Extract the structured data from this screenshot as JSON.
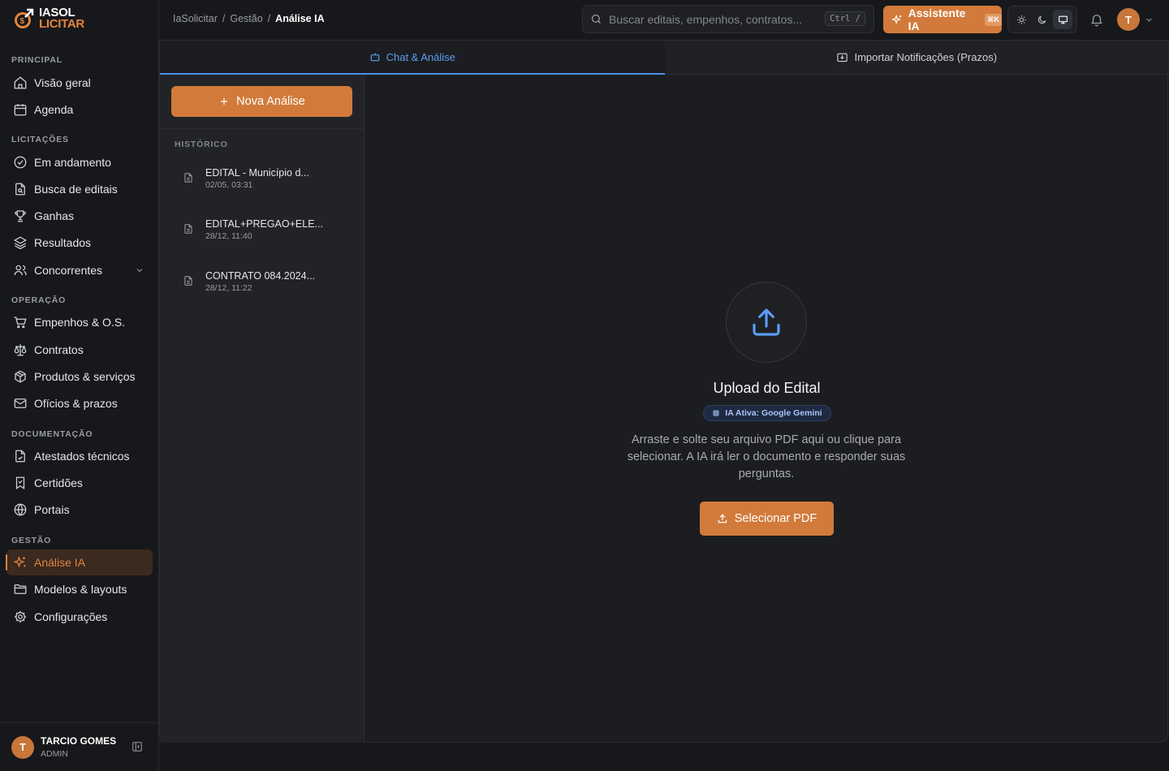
{
  "brand": {
    "line1": "IASOL",
    "line2": "LICITAR"
  },
  "sidebar": {
    "sections": [
      {
        "label": "Principal",
        "items": [
          {
            "label": "Visão geral",
            "icon": "home-icon"
          },
          {
            "label": "Agenda",
            "icon": "calendar-icon"
          }
        ]
      },
      {
        "label": "Licitações",
        "items": [
          {
            "label": "Em andamento",
            "icon": "check-circle-icon"
          },
          {
            "label": "Busca de editais",
            "icon": "file-search-icon"
          },
          {
            "label": "Ganhas",
            "icon": "trophy-icon"
          },
          {
            "label": "Resultados",
            "icon": "layers-icon"
          },
          {
            "label": "Concorrentes",
            "icon": "users-icon",
            "expandable": true
          }
        ]
      },
      {
        "label": "Operação",
        "items": [
          {
            "label": "Empenhos & O.S.",
            "icon": "cart-icon"
          },
          {
            "label": "Contratos",
            "icon": "scale-icon"
          },
          {
            "label": "Produtos & serviços",
            "icon": "package-icon"
          },
          {
            "label": "Ofícios & prazos",
            "icon": "mail-icon"
          }
        ]
      },
      {
        "label": "Documentação",
        "items": [
          {
            "label": "Atestados técnicos",
            "icon": "file-check-icon"
          },
          {
            "label": "Certidões",
            "icon": "bookmark-icon"
          },
          {
            "label": "Portais",
            "icon": "globe-icon"
          }
        ]
      },
      {
        "label": "Gestão",
        "items": [
          {
            "label": "Análise IA",
            "icon": "sparkles-icon",
            "active": true
          },
          {
            "label": "Modelos & layouts",
            "icon": "folder-icon"
          },
          {
            "label": "Configurações",
            "icon": "gear-icon"
          }
        ]
      }
    ]
  },
  "user": {
    "initial": "T",
    "name": "TARCIO GOMES",
    "role": "ADMIN"
  },
  "topbar": {
    "breadcrumbs": [
      "IaSolicitar",
      "Gestão",
      "Análise IA"
    ],
    "search_placeholder": "Buscar editais, empenhos, contratos...",
    "search_shortcut": "Ctrl /",
    "assistant_label": "Assistente IA",
    "assistant_shortcut": "⌘K",
    "theme_active": "system"
  },
  "tabs": [
    {
      "label": "Chat & Análise",
      "active": true
    },
    {
      "label": "Importar Notificações (Prazos)",
      "active": false
    }
  ],
  "history": {
    "new_button": "Nova Análise",
    "title": "Histórico",
    "items": [
      {
        "title": "EDITAL - Município d...",
        "date": "02/05, 03:31"
      },
      {
        "title": "EDITAL+PREGAO+ELE...",
        "date": "28/12, 11:40"
      },
      {
        "title": "CONTRATO 084.2024...",
        "date": "28/12, 11:22"
      }
    ]
  },
  "upload": {
    "title": "Upload do Edital",
    "badge": "IA Ativa: Google Gemini",
    "description": "Arraste e solte seu arquivo PDF aqui ou clique para selecionar. A IA irá ler o documento e responder suas perguntas.",
    "button": "Selecionar PDF"
  },
  "colors": {
    "accent": "#d27a3b",
    "link": "#5b9df5",
    "background": "#17181b"
  }
}
